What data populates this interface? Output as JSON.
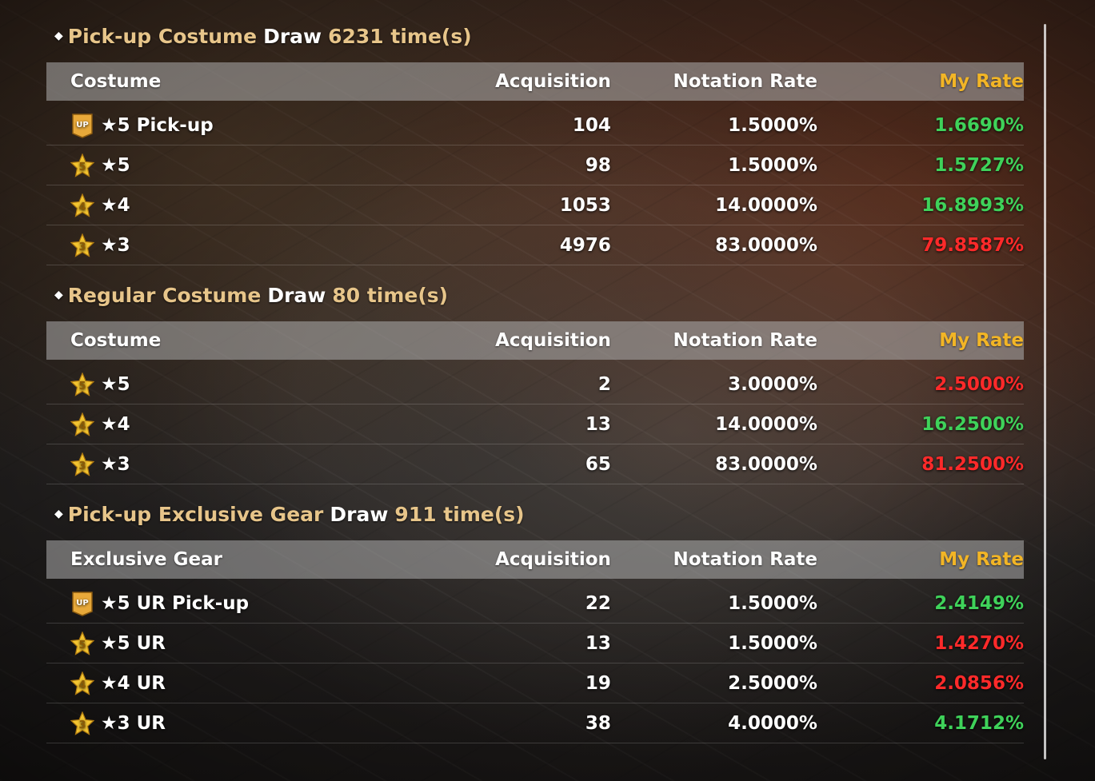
{
  "sections": [
    {
      "title_gold": "Pick-up Costume",
      "title_white": "Draw",
      "title_count": "6231 time(s)",
      "headers": {
        "name": "Costume",
        "acq": "Acquisition",
        "rate": "Notation Rate",
        "my": "My Rate"
      },
      "rows": [
        {
          "icon": "up-icon",
          "name": "★5 Pick-up",
          "acq": "104",
          "rate": "1.5000%",
          "my": "1.6690%",
          "status": "good"
        },
        {
          "icon": "star-5-icon",
          "name": "★5",
          "acq": "98",
          "rate": "1.5000%",
          "my": "1.5727%",
          "status": "good"
        },
        {
          "icon": "star-4-icon",
          "name": "★4",
          "acq": "1053",
          "rate": "14.0000%",
          "my": "16.8993%",
          "status": "good"
        },
        {
          "icon": "star-3-icon",
          "name": "★3",
          "acq": "4976",
          "rate": "83.0000%",
          "my": "79.8587%",
          "status": "bad"
        }
      ]
    },
    {
      "title_gold": "Regular Costume",
      "title_white": "Draw",
      "title_count": "80 time(s)",
      "headers": {
        "name": "Costume",
        "acq": "Acquisition",
        "rate": "Notation Rate",
        "my": "My Rate"
      },
      "rows": [
        {
          "icon": "star-5-icon",
          "name": "★5",
          "acq": "2",
          "rate": "3.0000%",
          "my": "2.5000%",
          "status": "bad"
        },
        {
          "icon": "star-4-icon",
          "name": "★4",
          "acq": "13",
          "rate": "14.0000%",
          "my": "16.2500%",
          "status": "good"
        },
        {
          "icon": "star-3-icon",
          "name": "★3",
          "acq": "65",
          "rate": "83.0000%",
          "my": "81.2500%",
          "status": "bad"
        }
      ]
    },
    {
      "title_gold": "Pick-up Exclusive Gear",
      "title_white": "Draw",
      "title_count": "911 time(s)",
      "headers": {
        "name": "Exclusive Gear",
        "acq": "Acquisition",
        "rate": "Notation Rate",
        "my": "My Rate"
      },
      "rows": [
        {
          "icon": "up-icon",
          "name": "★5 UR Pick-up",
          "acq": "22",
          "rate": "1.5000%",
          "my": "2.4149%",
          "status": "good"
        },
        {
          "icon": "star-5-icon",
          "name": "★5 UR",
          "acq": "13",
          "rate": "1.5000%",
          "my": "1.4270%",
          "status": "bad"
        },
        {
          "icon": "star-4-icon",
          "name": "★4 UR",
          "acq": "19",
          "rate": "2.5000%",
          "my": "2.0856%",
          "status": "bad"
        },
        {
          "icon": "star-3-icon",
          "name": "★3 UR",
          "acq": "38",
          "rate": "4.0000%",
          "my": "4.1712%",
          "status": "good"
        }
      ]
    }
  ],
  "colors": {
    "title_gold": "#e7c58a",
    "header_my": "#f2b526",
    "good": "#3fd25a",
    "bad": "#ff2a2a"
  }
}
